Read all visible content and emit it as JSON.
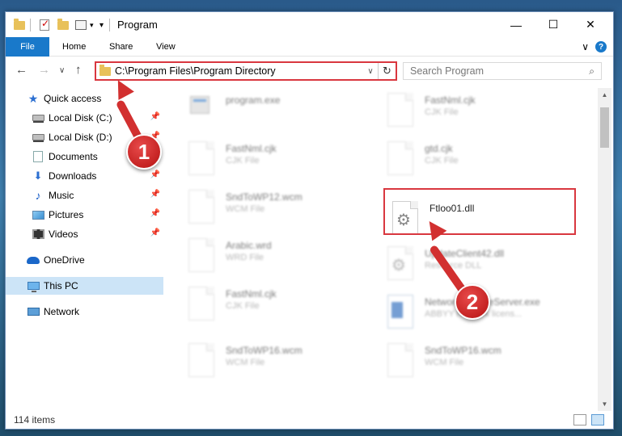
{
  "window": {
    "title": "Program",
    "minimize_glyph": "—",
    "maximize_glyph": "☐",
    "close_glyph": "✕"
  },
  "ribbon": {
    "tabs": [
      "File",
      "Home",
      "Share",
      "View"
    ],
    "expand_glyph": "∨",
    "help_glyph": "?"
  },
  "nav": {
    "back_glyph": "←",
    "forward_glyph": "→",
    "recent_glyph": "∨",
    "up_glyph": "↑"
  },
  "address": {
    "path": "C:\\Program Files\\Program Directory",
    "dropdown_glyph": "∨",
    "refresh_glyph": "↻"
  },
  "search": {
    "placeholder": "Search Program",
    "icon": "search-icon"
  },
  "sidebar": {
    "items": [
      {
        "label": "Quick access",
        "icon": "star-icon",
        "pinned": false
      },
      {
        "label": "Local Disk (C:)",
        "icon": "disk-icon",
        "pinned": true
      },
      {
        "label": "Local Disk (D:)",
        "icon": "disk-icon",
        "pinned": true
      },
      {
        "label": "Documents",
        "icon": "documents-icon",
        "pinned": true
      },
      {
        "label": "Downloads",
        "icon": "download-icon",
        "pinned": true
      },
      {
        "label": "Music",
        "icon": "music-icon",
        "pinned": true
      },
      {
        "label": "Pictures",
        "icon": "pictures-icon",
        "pinned": true
      },
      {
        "label": "Videos",
        "icon": "videos-icon",
        "pinned": true
      },
      {
        "label": "OneDrive",
        "icon": "cloud-icon",
        "pinned": false
      },
      {
        "label": "This PC",
        "icon": "pc-icon",
        "pinned": false,
        "selected": true
      },
      {
        "label": "Network",
        "icon": "network-icon",
        "pinned": false
      }
    ]
  },
  "files": [
    {
      "name": "program.exe",
      "type": ""
    },
    {
      "name": "FastNml.cjk",
      "type": "CJK File"
    },
    {
      "name": "FastNml.cjk",
      "type": "CJK File"
    },
    {
      "name": "gtd.cjk",
      "type": "CJK File"
    },
    {
      "name": "SndToWP12.wcm",
      "type": "WCM File"
    },
    {
      "name": "Ftloo01.dll",
      "type": ""
    },
    {
      "name": "Arabic.wrd",
      "type": "WRD File"
    },
    {
      "name": "UpdateClient42.dll",
      "type": "Resource DLL"
    },
    {
      "name": "FastNml.cjk",
      "type": "CJK File"
    },
    {
      "name": "NetworkLicenseServer.exe",
      "type": "ABBYY Network licens..."
    },
    {
      "name": "SndToWP16.wcm",
      "type": "WCM File"
    },
    {
      "name": "SndToWP16.wcm",
      "type": "WCM File"
    }
  ],
  "status": {
    "item_count": "114 items"
  },
  "annotations": {
    "marker_1": "1",
    "marker_2": "2"
  },
  "colors": {
    "accent": "#1979ca",
    "highlight": "#d9373f",
    "selection": "#cce4f7"
  }
}
